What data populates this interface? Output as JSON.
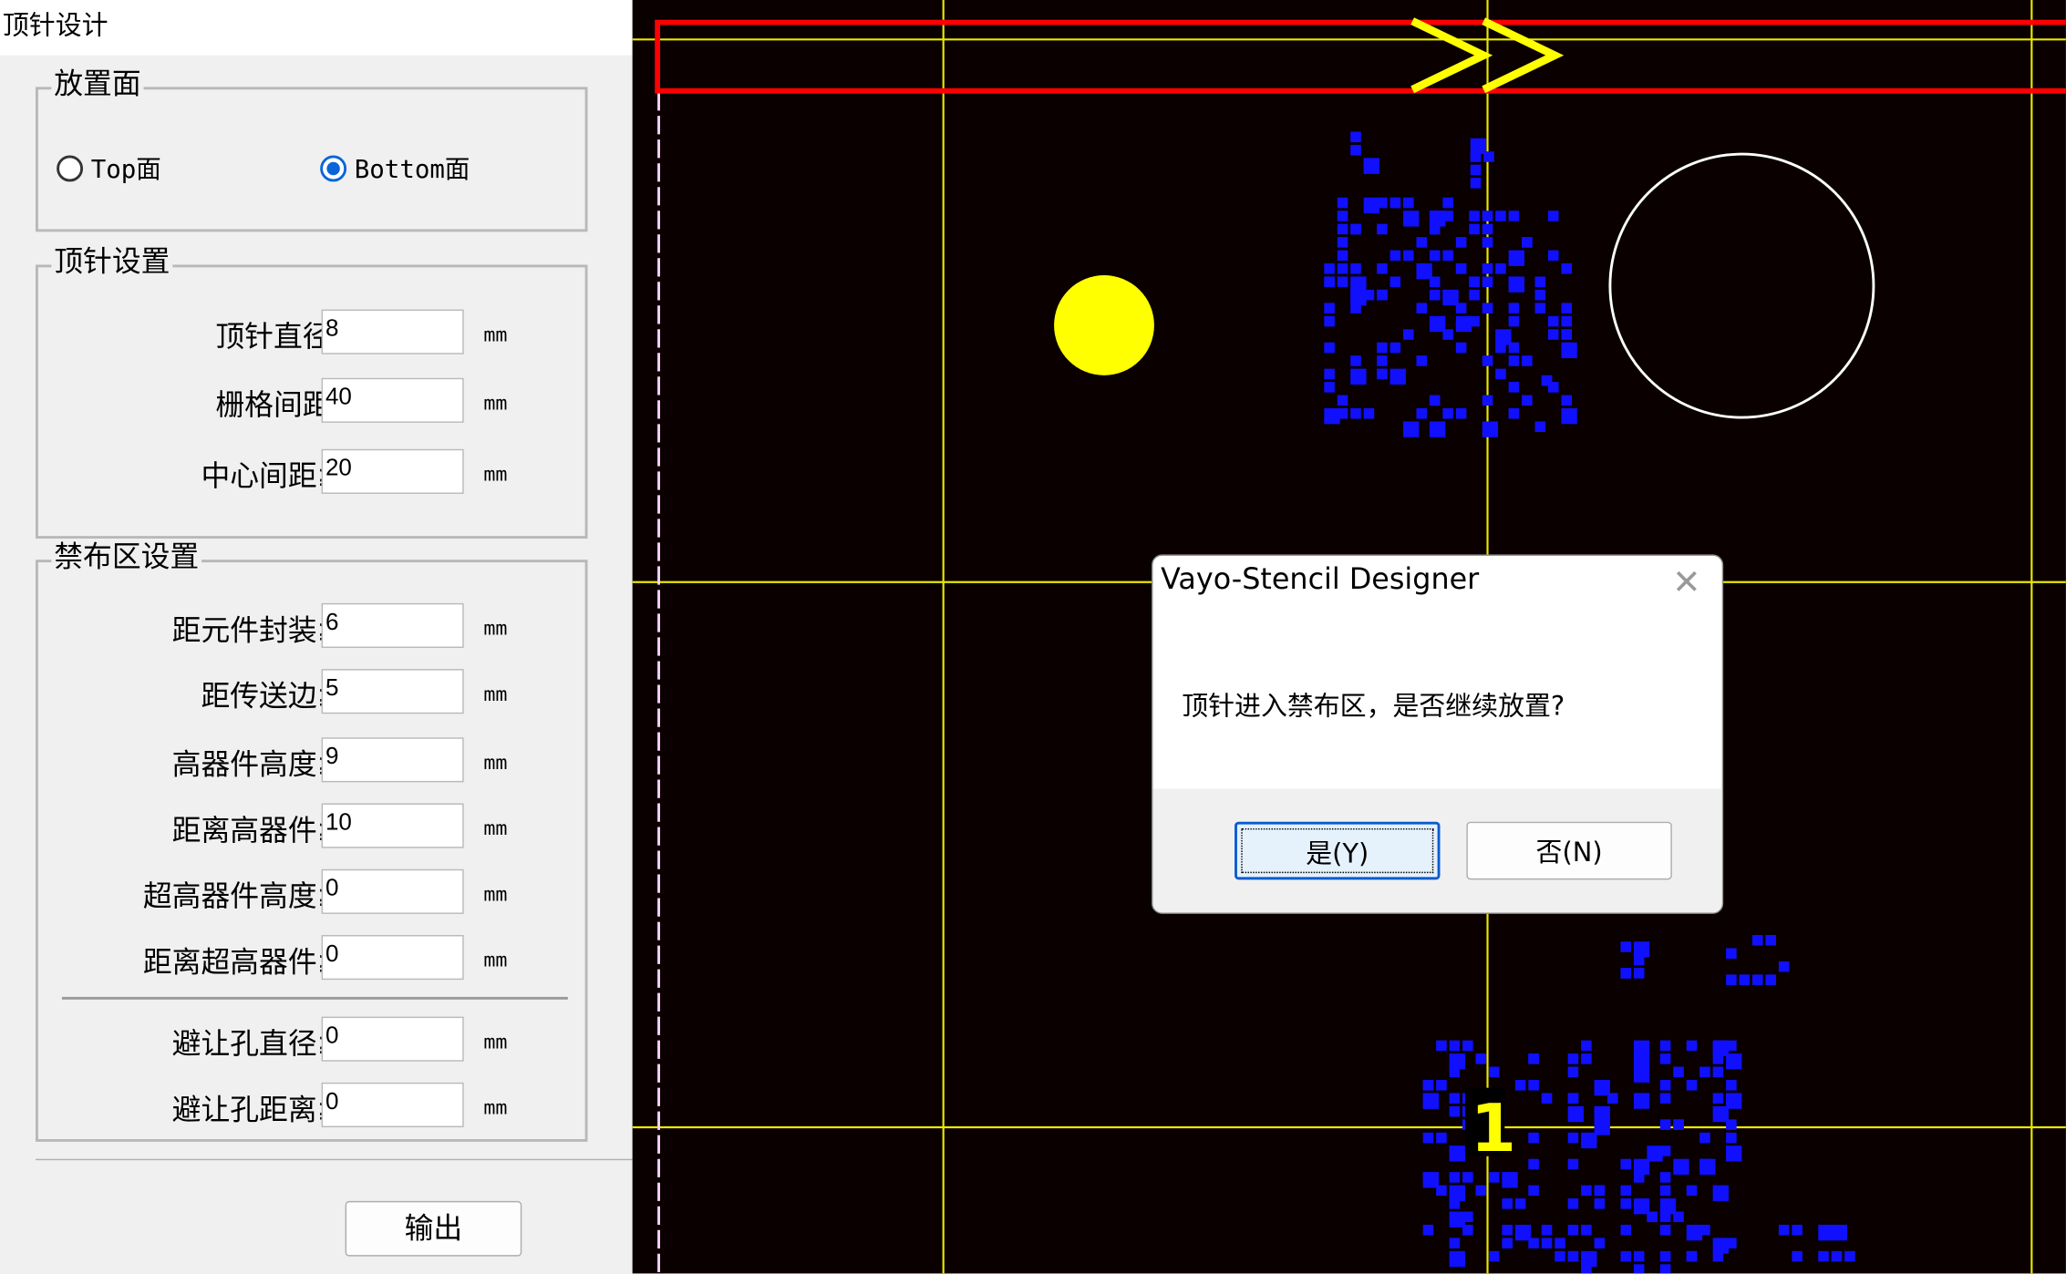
{
  "panel": {
    "title": "顶针设计",
    "placement_group": {
      "label": "放置面",
      "options": [
        {
          "label": "Top面",
          "selected": false
        },
        {
          "label": "Bottom面",
          "selected": true
        }
      ]
    },
    "pin_group": {
      "label": "顶针设置",
      "fields": [
        {
          "label": "顶针直径:",
          "value": "8",
          "unit": "mm"
        },
        {
          "label": "栅格间距:",
          "value": "40",
          "unit": "mm"
        },
        {
          "label": "中心间距≥",
          "value": "20",
          "unit": "mm"
        }
      ]
    },
    "keepout_group": {
      "label": "禁布区设置",
      "fields": [
        {
          "label": "距元件封装≥",
          "value": "6",
          "unit": "mm"
        },
        {
          "label": "距传送边≥",
          "value": "5",
          "unit": "mm"
        },
        {
          "label": "高器件高度≥",
          "value": "9",
          "unit": "mm"
        },
        {
          "label": "距离高器件≥",
          "value": "10",
          "unit": "mm"
        },
        {
          "label": "超高器件高度≥",
          "value": "0",
          "unit": "mm"
        },
        {
          "label": "距离超高器件≥",
          "value": "0",
          "unit": "mm"
        },
        {
          "label": "避让孔直径≥",
          "value": "0",
          "unit": "mm"
        },
        {
          "label": "避让孔距离≥",
          "value": "0",
          "unit": "mm"
        }
      ]
    },
    "output_button": "输出"
  },
  "canvas": {
    "marker_label": "1",
    "arrow_glyph": ">>",
    "colors": {
      "background": "#0a0000",
      "grid": "#e8e800",
      "board": "#ff0000",
      "pads": "#1010ff",
      "pin": "#ffff00",
      "hole": "#ffffff"
    }
  },
  "dialog": {
    "title": "Vayo-Stencil Designer",
    "message": "顶针进入禁布区，是否继续放置?",
    "yes_button": "是(Y)",
    "no_button": "否(N)",
    "close_icon": "close-icon"
  }
}
